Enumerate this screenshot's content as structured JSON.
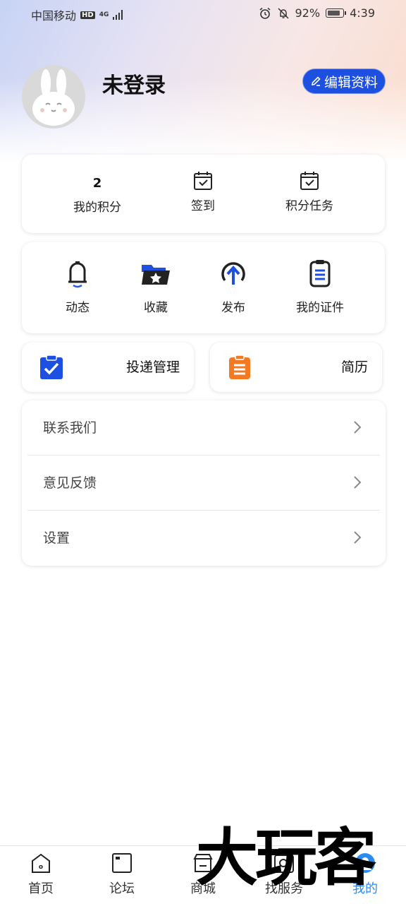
{
  "status_bar": {
    "carrier": "中国移动",
    "hd": "HD",
    "network": "4G",
    "battery_percent": "92%",
    "time": "4:39"
  },
  "profile": {
    "username": "未登录",
    "edit_label": "编辑资料"
  },
  "points": {
    "my_points_value": "2",
    "my_points_label": "我的积分",
    "checkin_label": "签到",
    "tasks_label": "积分任务"
  },
  "functions": [
    {
      "label": "动态",
      "icon": "bell-icon"
    },
    {
      "label": "收藏",
      "icon": "folder-star-icon"
    },
    {
      "label": "发布",
      "icon": "upload-icon"
    },
    {
      "label": "我的证件",
      "icon": "clipboard-icon"
    }
  ],
  "quick": {
    "delivery_label": "投递管理",
    "resume_label": "简历"
  },
  "menu": [
    {
      "label": "联系我们"
    },
    {
      "label": "意见反馈"
    },
    {
      "label": "设置"
    }
  ],
  "tabs": [
    {
      "label": "首页",
      "icon": "home-icon"
    },
    {
      "label": "论坛",
      "icon": "forum-icon"
    },
    {
      "label": "商城",
      "icon": "store-icon"
    },
    {
      "label": "找服务",
      "icon": "search-service-icon"
    },
    {
      "label": "我的",
      "icon": "profile-icon"
    }
  ],
  "watermark": "大玩客",
  "colors": {
    "accent": "#1d4fe0",
    "active_tab": "#2a8bf2",
    "resume_orange": "#f47a22"
  }
}
